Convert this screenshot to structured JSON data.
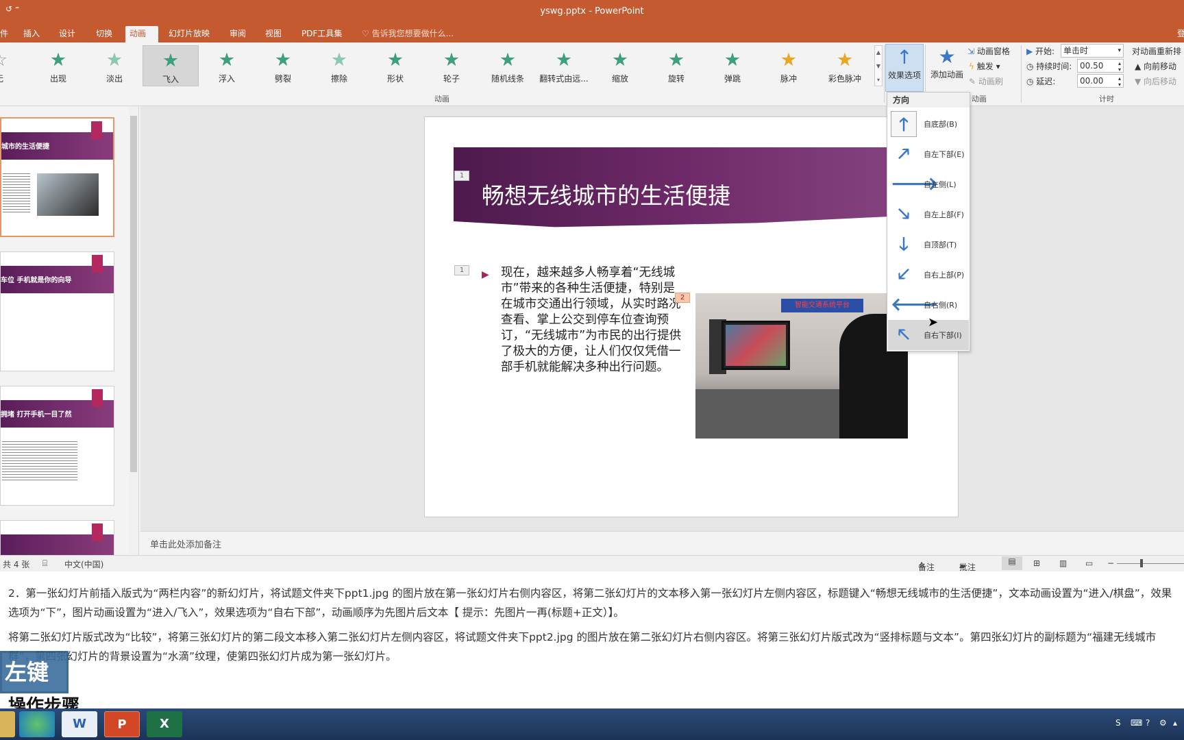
{
  "window": {
    "title": "yswg.pptx - PowerPoint",
    "qa_icons": "↺ ⁼"
  },
  "tabs": [
    {
      "label": "件"
    },
    {
      "label": "插入"
    },
    {
      "label": "设计"
    },
    {
      "label": "切换"
    },
    {
      "label": "动画"
    },
    {
      "label": "幻灯片放映"
    },
    {
      "label": "审阅"
    },
    {
      "label": "视图"
    },
    {
      "label": "PDF工具集"
    }
  ],
  "tell_me": "告诉我您想要做什么...",
  "right_edge": "登",
  "gallery": {
    "items": [
      {
        "label": "无",
        "icon": "☆"
      },
      {
        "label": "出现",
        "icon": "★"
      },
      {
        "label": "淡出",
        "icon": "★"
      },
      {
        "label": "飞入",
        "icon": "★"
      },
      {
        "label": "浮入",
        "icon": "★"
      },
      {
        "label": "劈裂",
        "icon": "★"
      },
      {
        "label": "擦除",
        "icon": "★"
      },
      {
        "label": "形状",
        "icon": "★"
      },
      {
        "label": "轮子",
        "icon": "★"
      },
      {
        "label": "随机线条",
        "icon": "★"
      },
      {
        "label": "翻转式由远...",
        "icon": "★"
      },
      {
        "label": "缩放",
        "icon": "★"
      },
      {
        "label": "旋转",
        "icon": "★"
      },
      {
        "label": "弹跳",
        "icon": "★"
      },
      {
        "label": "脉冲",
        "icon": "★"
      },
      {
        "label": "彩色脉冲",
        "icon": "★"
      }
    ],
    "selected": "飞入",
    "group_label": "动画"
  },
  "effect_options": {
    "label": "效果选项",
    "icon": "↑"
  },
  "add_animation": {
    "label": "添加动画",
    "icon": "★"
  },
  "advanced": {
    "pane": "动画窗格",
    "trigger": "触发",
    "painter": "动画刷",
    "group_label": "动画"
  },
  "timing": {
    "start_label": "开始:",
    "start_value": "单击时",
    "duration_label": "持续时间:",
    "duration_value": "00.50",
    "delay_label": "延迟:",
    "delay_value": "00.00",
    "reorder_label": "对动画重新排",
    "move_earlier": "向前移动",
    "move_later": "向后移动",
    "group_label": "计时"
  },
  "direction_menu": {
    "header": "方向",
    "items": [
      {
        "label": "自底部(B)",
        "icon": "🡑"
      },
      {
        "label": "自左下部(E)",
        "icon": "🡕"
      },
      {
        "label": "自左侧(L)",
        "icon": "🡒"
      },
      {
        "label": "自左上部(F)",
        "icon": "🡖"
      },
      {
        "label": "自顶部(T)",
        "icon": "🡓"
      },
      {
        "label": "自右上部(P)",
        "icon": "🡗"
      },
      {
        "label": "自右侧(R)",
        "icon": "🡐"
      },
      {
        "label": "自右下部(I)",
        "icon": "🡔"
      }
    ]
  },
  "thumbnails": [
    {
      "title": "城市的生活便捷"
    },
    {
      "title": "车位 手机就是你的向导"
    },
    {
      "title": "拥堵 打开手机一目了然"
    },
    {
      "title": ""
    }
  ],
  "slide": {
    "title": "畅想无线城市的生活便捷",
    "tag_title": "1",
    "tag_body": "1",
    "tag_image": "2",
    "body": "现在，越来越多人畅享着“无线城市”带来的各种生活便捷，特别是在城市交通出行领域，从实时路况查看、掌上公交到停车位查询预订，“无线城市”为市民的出行提供了极大的方便，让人们仅仅凭借一部手机就能解决多种出行问题。",
    "photo_sign": "智能交通系统平台"
  },
  "notes_placeholder": "单击此处添加备注",
  "status": {
    "slides": "共 4 张",
    "language": "中文(中国)",
    "notes_btn": "备注",
    "comments_btn": "批注"
  },
  "document": {
    "para1": "2．第一张幻灯片前插入版式为“两栏内容”的新幻灯片，将试题文件夹下ppt1.jpg 的图片放在第一张幻灯片右侧内容区，将第二张幻灯片的文本移入第一张幻灯片左侧内容区，标题键入“畅想无线城市的生活便捷”，文本动画设置为“进入/棋盘”，效果选项为“下”，图片动画设置为“进入/飞入”，效果选项为“自右下部”，动画顺序为先图片后文本【 提示：先图片一再(标题+正文）】。",
    "para2": "将第二张幻灯片版式改为“比较”，将第三张幻灯片的第二段文本移入第二张幻灯片左侧内容区，将试题文件夹下ppt2.jpg 的图片放在第二张幻灯片右侧内容区。将第三张幻灯片版式改为“竖排标题与文本”。第四张幻灯片的副标题为“福建无线城市群”，第四张幻灯片的背景设置为“水滴”纹理，使第四张幻灯片成为第一张幻灯片。",
    "heading": "操作步骤"
  },
  "key_badge": "左键>",
  "taskbar": [
    {
      "label": ""
    },
    {
      "label": ""
    },
    {
      "label": "W"
    },
    {
      "label": "P"
    },
    {
      "label": "X"
    }
  ],
  "colors": {
    "ribbon_orange": "#c55a31",
    "accent_blue": "#3a77c6",
    "slide_purple": "#5a1d5a"
  }
}
